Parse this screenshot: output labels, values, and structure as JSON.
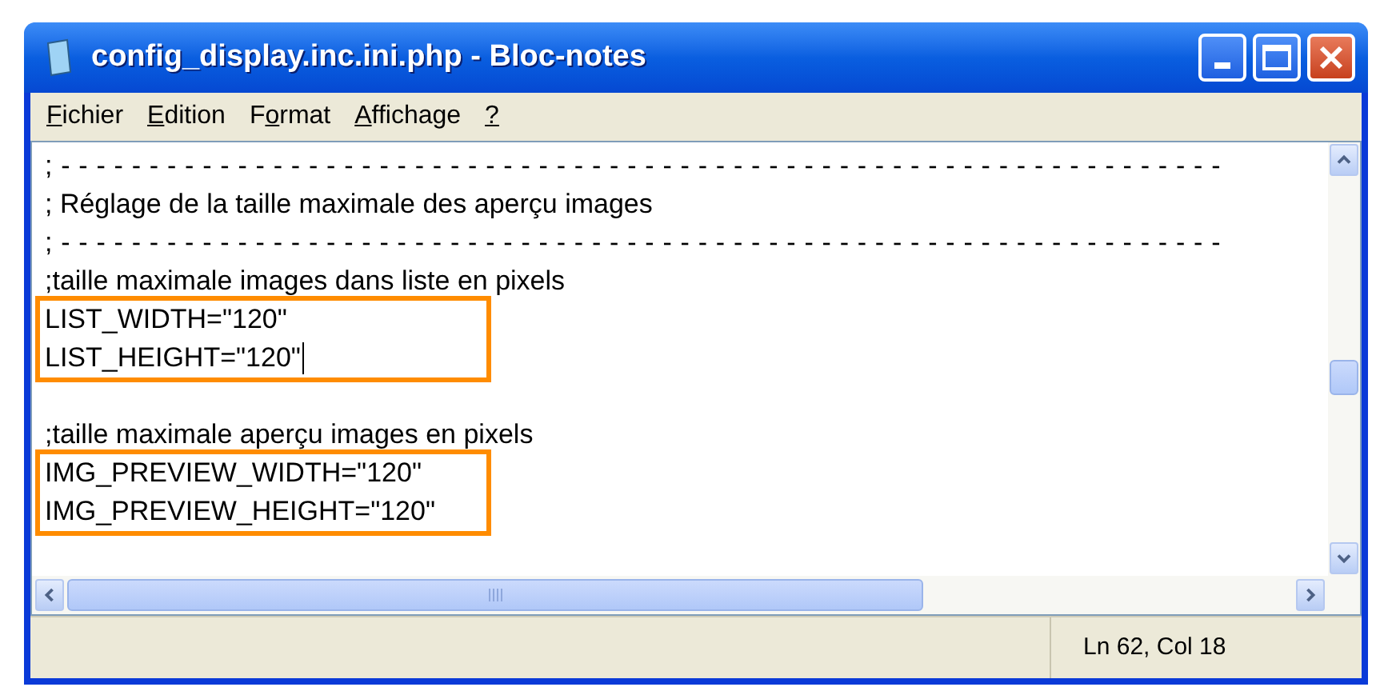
{
  "window": {
    "title": "config_display.inc.ini.php - Bloc-notes"
  },
  "menu": [
    {
      "access_key": "F",
      "rest": "ichier"
    },
    {
      "access_key": "E",
      "rest": "dition"
    },
    {
      "before": "F",
      "access_key": "o",
      "rest": "rmat"
    },
    {
      "access_key": "A",
      "rest": "ffichage"
    },
    {
      "access_key": "?"
    }
  ],
  "blocks": [
    {
      "highlighted": false,
      "gap_before": false,
      "lines": [
        {
          "kind": "rule",
          "text": ";------------------------------------------------------------------",
          "caret": false
        },
        {
          "kind": "text",
          "text": "; Réglage de la taille maximale des aperçu images",
          "caret": false
        },
        {
          "kind": "rule",
          "text": ";------------------------------------------------------------------",
          "caret": false
        },
        {
          "kind": "text",
          "text": ";taille maximale images dans liste en pixels",
          "caret": false
        }
      ]
    },
    {
      "highlighted": true,
      "gap_before": false,
      "lines": [
        {
          "kind": "text",
          "text": "LIST_WIDTH=\"120\"",
          "caret": false
        },
        {
          "kind": "text",
          "text": "LIST_HEIGHT=\"120\"",
          "caret": true
        }
      ]
    },
    {
      "highlighted": false,
      "gap_before": true,
      "lines": [
        {
          "kind": "text",
          "text": ";taille maximale aperçu images en pixels",
          "caret": false
        }
      ]
    },
    {
      "highlighted": true,
      "gap_before": false,
      "lines": [
        {
          "kind": "text",
          "text": "IMG_PREVIEW_WIDTH=\"120\"",
          "caret": false
        },
        {
          "kind": "text",
          "text": "IMG_PREVIEW_HEIGHT=\"120\"",
          "caret": false
        }
      ]
    }
  ],
  "status_bar": {
    "position": "Ln 62, Col 18"
  }
}
